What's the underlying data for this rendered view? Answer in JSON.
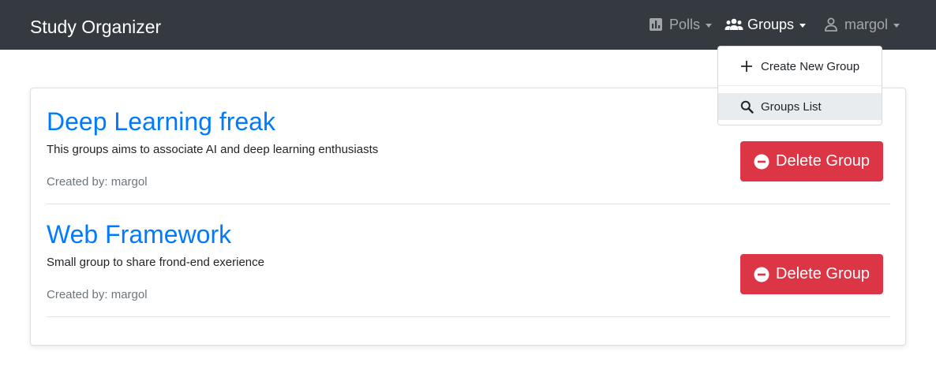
{
  "navbar": {
    "brand": "Study Organizer",
    "items": [
      {
        "label": "Polls",
        "icon": "chart-icon"
      },
      {
        "label": "Groups",
        "icon": "users-icon"
      },
      {
        "label": "margol",
        "icon": "user-icon"
      }
    ]
  },
  "groups_menu": {
    "items": [
      {
        "label": "Create New Group",
        "icon": "plus-icon"
      },
      {
        "label": "Groups List",
        "icon": "search-icon"
      }
    ]
  },
  "groups": [
    {
      "title": "Deep Learning freak",
      "description": "This groups aims to associate AI and deep learning enthusiasts",
      "created_by": "Created by: margol",
      "delete_label": "Delete Group"
    },
    {
      "title": "Web Framework",
      "description": "Small group to share frond-end exerience",
      "created_by": "Created by: margol",
      "delete_label": "Delete Group"
    }
  ],
  "colors": {
    "navbar": "#343a40",
    "link": "#007bff",
    "danger": "#dc3545"
  }
}
